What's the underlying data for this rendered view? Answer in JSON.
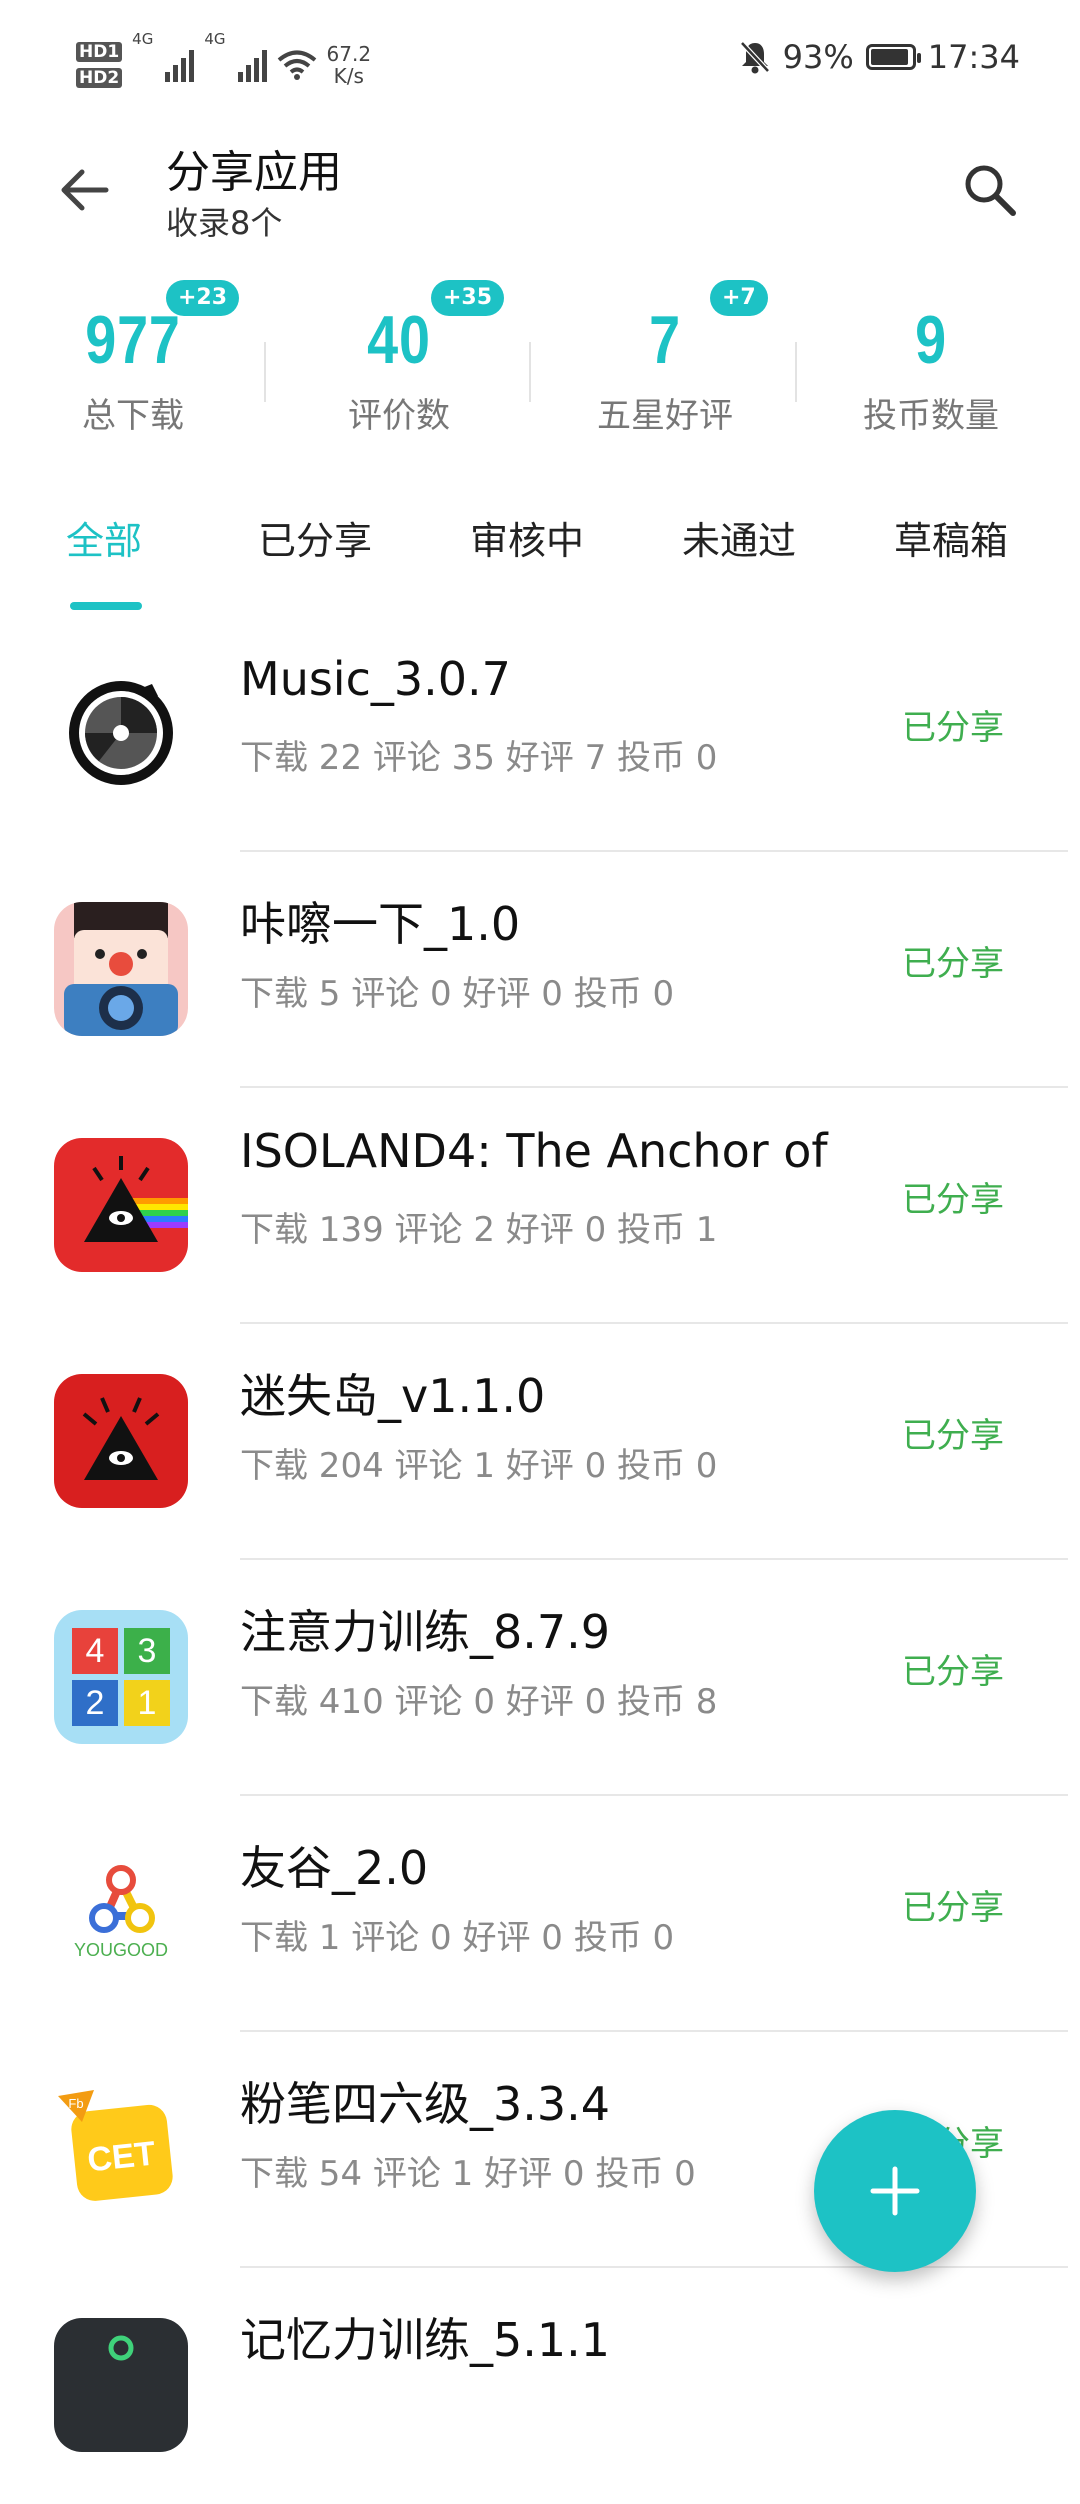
{
  "status_bar": {
    "hd1": "HD1",
    "hd2": "HD2",
    "net1": "4G",
    "net2": "4G",
    "speed_value": "67.2",
    "speed_unit": "K/s",
    "battery": "93%",
    "time": "17:34"
  },
  "header": {
    "title": "分享应用",
    "subtitle": "收录8个"
  },
  "stats": [
    {
      "value": "977",
      "label": "总下载",
      "badge": "+23"
    },
    {
      "value": "40",
      "label": "评价数",
      "badge": "+35"
    },
    {
      "value": "7",
      "label": "五星好评",
      "badge": "+7"
    },
    {
      "value": "9",
      "label": "投币数量",
      "badge": ""
    }
  ],
  "tabs": [
    {
      "label": "全部"
    },
    {
      "label": "已分享"
    },
    {
      "label": "审核中"
    },
    {
      "label": "未通过"
    },
    {
      "label": "草稿箱"
    }
  ],
  "apps": [
    {
      "name": "Music_3.0.7",
      "meta": "下载 22  评论 35  好评 7  投币 0",
      "status": "已分享"
    },
    {
      "name": "咔嚓一下_1.0",
      "meta": "下载 5  评论 0  好评 0  投币 0",
      "status": "已分享"
    },
    {
      "name": "ISOLAND4: The Anchor of …",
      "meta": "下载 139  评论 2  好评 0  投币 1",
      "status": "已分享"
    },
    {
      "name": "迷失岛_v1.1.0",
      "meta": "下载 204  评论 1  好评 0  投币 0",
      "status": "已分享"
    },
    {
      "name": "注意力训练_8.7.9",
      "meta": "下载 410  评论 0  好评 0  投币 8",
      "status": "已分享",
      "icon_digits": [
        "4",
        "3",
        "2",
        "1"
      ]
    },
    {
      "name": "友谷_2.0",
      "meta": "下载 1  评论 0  好评 0  投币 0",
      "status": "已分享",
      "icon_text": "YOUGOOD"
    },
    {
      "name": "粉笔四六级_3.3.4",
      "meta": "下载 54  评论 1  好评 0  投币 0",
      "status": "已分享",
      "icon_text": "CET",
      "icon_corner": "Fb"
    },
    {
      "name": "记忆力训练_5.1.1",
      "meta": "",
      "status": ""
    }
  ],
  "colors": {
    "accent": "#1dc2c5",
    "shared": "#3fae4f"
  }
}
